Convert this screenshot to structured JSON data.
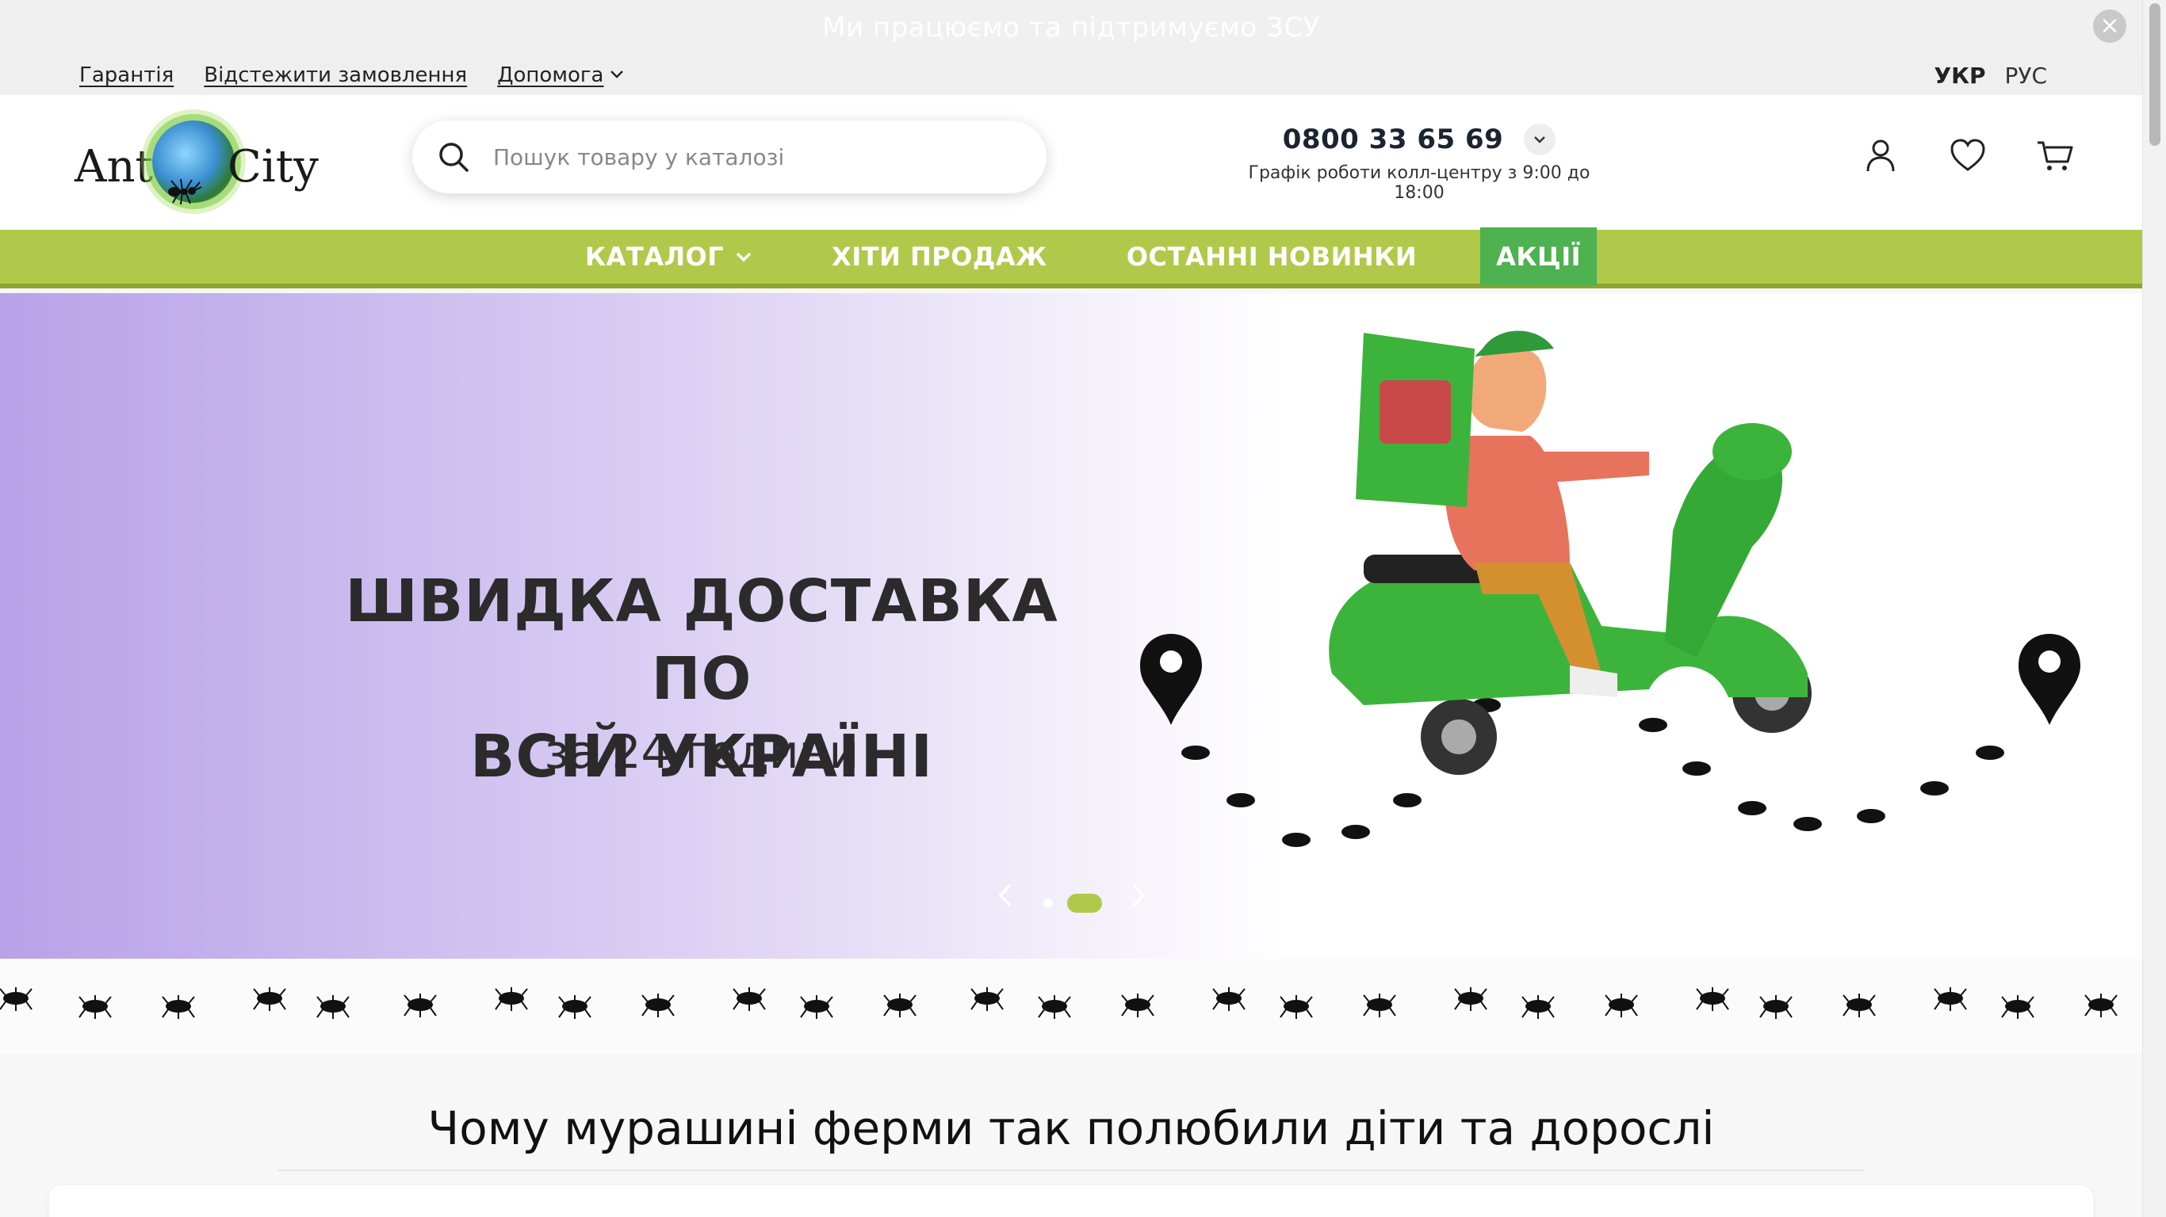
{
  "announcement": {
    "text": "Ми працюємо та підтримуємо ЗСУ",
    "close_glyph": "×"
  },
  "utility": {
    "links": [
      "Гарантія",
      "Відстежити замовлення",
      "Допомога"
    ],
    "help_chevron": "⌄",
    "languages": {
      "active": "УКР",
      "other": "РУС"
    }
  },
  "logo": {
    "left_word": "Ant",
    "right_word": "City"
  },
  "search": {
    "placeholder": "Пошук товару у каталозі",
    "value": ""
  },
  "contact": {
    "phone": "0800 33 65 69",
    "schedule": "Графік роботи колл-центру з 9:00 до 18:00"
  },
  "header_icons": [
    "user-icon",
    "heart-icon",
    "cart-icon"
  ],
  "nav": {
    "catalog": "КАТАЛОГ",
    "bestsellers": "ХІТИ ПРОДАЖ",
    "new": "ОСТАННІ НОВИНКИ",
    "promo": "АКЦІЇ"
  },
  "hero": {
    "title_line1": "ШВИДКА ДОСТАВКА ПО",
    "title_line2": "ВСІЙ УКРАЇНІ",
    "subtitle": "за 24 години",
    "slides": 2,
    "active_slide": 2
  },
  "section": {
    "heading": "Чому мурашині ферми так полюбили діти та дорослі"
  },
  "colors": {
    "nav_green": "#b1c94b",
    "promo_green": "#4db24f",
    "hero_purple": "#b8a2e8",
    "scooter_green": "#3cb43c"
  }
}
